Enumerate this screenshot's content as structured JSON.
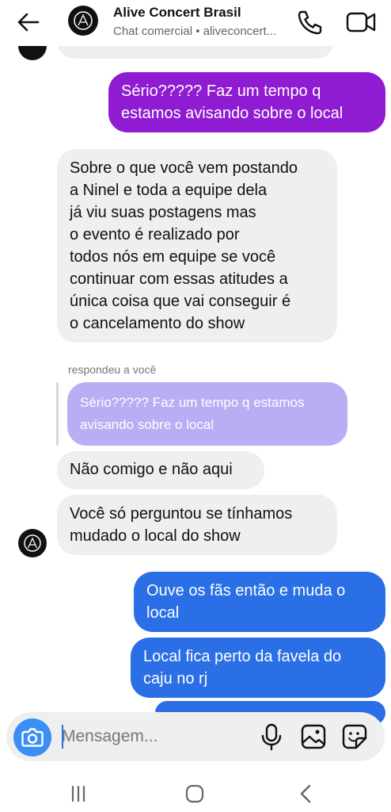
{
  "header": {
    "title": "Alive Concert Brasil",
    "subtitle": "Chat comercial • aliveconcert...",
    "back_icon": "arrow-left-icon",
    "call_icon": "phone-icon",
    "video_icon": "video-camera-icon"
  },
  "messages": [
    {
      "from": "me",
      "color": "#8f1bd2",
      "lines": [
        "Sério????? Faz um tempo q",
        "estamos avisando sobre o local"
      ]
    },
    {
      "from": "them",
      "lines": [
        "Sobre o que você vem postando",
        "a Ninel e toda a equipe dela",
        "já viu suas postagens mas",
        "o evento é realizado por",
        "todos nós em equipe se você",
        "continuar com essas atitudes a",
        "única coisa que vai conseguir é",
        "o cancelamento do show"
      ]
    },
    {
      "from": "them",
      "reply_label": "respondeu a você",
      "quoted_lines": [
        "Sério????? Faz um tempo q estamos",
        "avisando sobre o local"
      ],
      "lines": [
        "Não comigo e não aqui"
      ]
    },
    {
      "from": "them",
      "lines": [
        "Você só perguntou se tínhamos",
        "mudado o local do show"
      ]
    },
    {
      "from": "me",
      "color": "#2a6fe5",
      "lines": [
        "Ouve os fãs então e muda o",
        "local"
      ]
    },
    {
      "from": "me",
      "color": "#2a6fe5",
      "lines": [
        "Local fica perto da favela do",
        "caju no rj"
      ]
    }
  ],
  "composer": {
    "placeholder": "Mensagem...",
    "camera_icon": "camera-icon",
    "mic_icon": "microphone-icon",
    "gallery_icon": "image-gallery-icon",
    "sticker_icon": "sticker-icon"
  },
  "navbar": {
    "recents_icon": "recents-icon",
    "home_icon": "home-icon",
    "back_icon": "back-chevron-icon"
  },
  "colors": {
    "sent_purple": "#8f1bd2",
    "sent_blue": "#2a6fe5",
    "received": "#efefef",
    "quoted": "#b9aef3",
    "camera_button": "#3a8ff3"
  }
}
